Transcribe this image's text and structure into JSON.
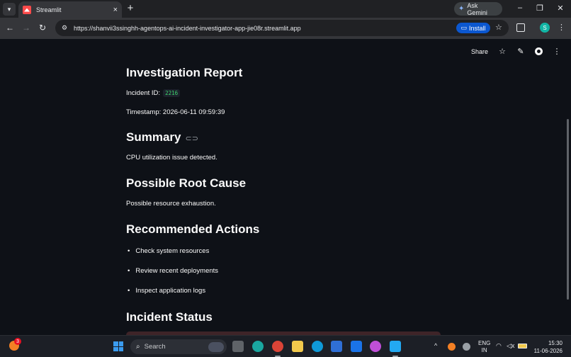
{
  "browser": {
    "tab_title": "Streamlit",
    "tab_close": "×",
    "new_tab": "+",
    "gemini_label": "Ask Gemini",
    "window_controls": {
      "minimize": "–",
      "restore": "❐",
      "close": "✕"
    },
    "nav": {
      "back": "←",
      "forward": "→",
      "reload": "↻"
    },
    "url": "https://shanvii3ssinghh-agentops-ai-incident-investigator-app-jie08r.streamlit.app",
    "install_label": "Install",
    "bookmark": "☆",
    "profile_initial": "S",
    "menu": "⋮"
  },
  "streamlit_header": {
    "share_label": "Share",
    "star": "☆",
    "edit": "✎",
    "menu": "⋮"
  },
  "report": {
    "title": "Investigation Report",
    "incident_id_label": "Incident ID:",
    "incident_id_value": "2216",
    "timestamp": "Timestamp: 2026-06-11 09:59:39",
    "summary_heading": "Summary",
    "summary_text": "CPU utilization issue detected.",
    "root_cause_heading": "Possible Root Cause",
    "root_cause_text": "Possible resource exhaustion.",
    "actions_heading": "Recommended Actions",
    "actions": [
      "Check system resources",
      "Review recent deployments",
      "Inspect application logs"
    ],
    "status_heading": "Incident Status"
  },
  "taskbar": {
    "notification_count": "3",
    "search_label": "Search",
    "lang_primary": "ENG",
    "lang_secondary": "IN",
    "time": "15:30",
    "date": "11-06-2026",
    "tray_chevron": "^"
  },
  "colors": {
    "page_bg": "#0e1117",
    "code_text": "#3dd56d",
    "install_btn": "#0b57d0",
    "status_box": "#3e2428"
  }
}
